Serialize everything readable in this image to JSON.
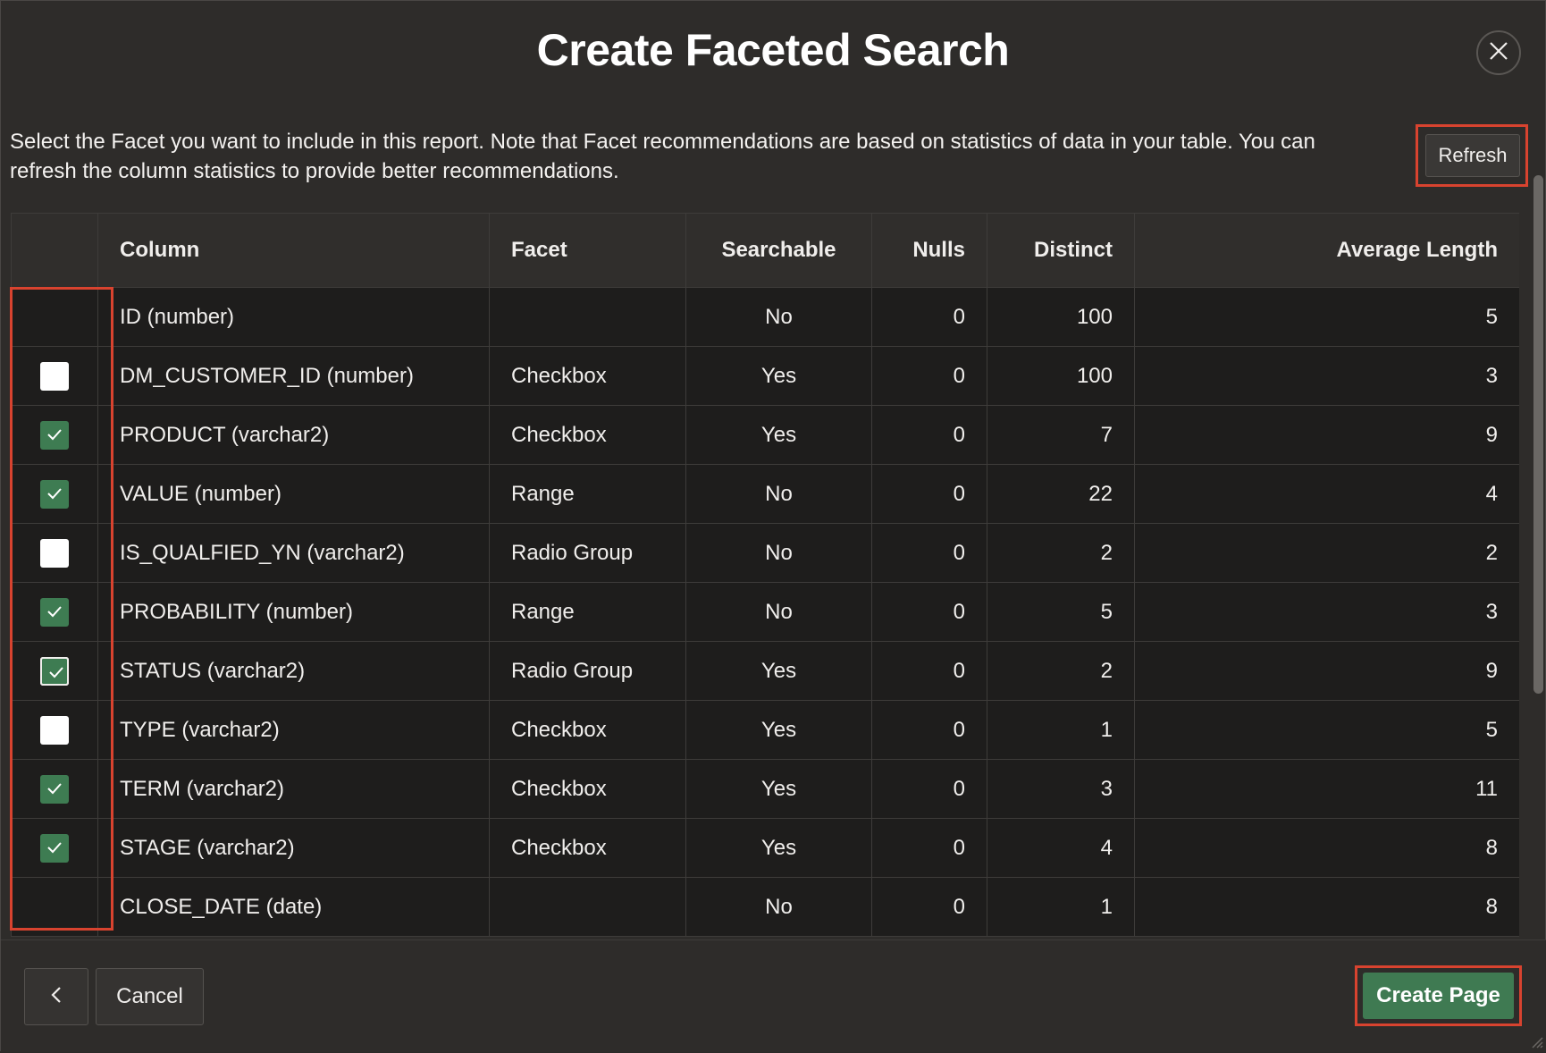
{
  "dialog": {
    "title": "Create Faceted Search",
    "intro": "Select the Facet you want to include in this report. Note that Facet recommendations are based on statistics of data in your table. You can refresh the column statistics to provide better recommendations.",
    "refresh_label": "Refresh",
    "close_icon": "close-icon"
  },
  "table": {
    "headers": {
      "select": "",
      "column": "Column",
      "facet": "Facet",
      "searchable": "Searchable",
      "nulls": "Nulls",
      "distinct": "Distinct",
      "avg_length": "Average Length"
    },
    "rows": [
      {
        "checkbox": "none",
        "column": "ID (number)",
        "facet": "",
        "searchable": "No",
        "nulls": "0",
        "distinct": "100",
        "avg_length": "5"
      },
      {
        "checkbox": "unchecked",
        "column": "DM_CUSTOMER_ID (number)",
        "facet": "Checkbox",
        "searchable": "Yes",
        "nulls": "0",
        "distinct": "100",
        "avg_length": "3"
      },
      {
        "checkbox": "checked",
        "column": "PRODUCT (varchar2)",
        "facet": "Checkbox",
        "searchable": "Yes",
        "nulls": "0",
        "distinct": "7",
        "avg_length": "9"
      },
      {
        "checkbox": "checked",
        "column": "VALUE (number)",
        "facet": "Range",
        "searchable": "No",
        "nulls": "0",
        "distinct": "22",
        "avg_length": "4"
      },
      {
        "checkbox": "unchecked",
        "column": "IS_QUALFIED_YN (varchar2)",
        "facet": "Radio Group",
        "searchable": "No",
        "nulls": "0",
        "distinct": "2",
        "avg_length": "2"
      },
      {
        "checkbox": "checked",
        "column": "PROBABILITY (number)",
        "facet": "Range",
        "searchable": "No",
        "nulls": "0",
        "distinct": "5",
        "avg_length": "3"
      },
      {
        "checkbox": "checked-focused",
        "column": "STATUS (varchar2)",
        "facet": "Radio Group",
        "searchable": "Yes",
        "nulls": "0",
        "distinct": "2",
        "avg_length": "9"
      },
      {
        "checkbox": "unchecked",
        "column": "TYPE (varchar2)",
        "facet": "Checkbox",
        "searchable": "Yes",
        "nulls": "0",
        "distinct": "1",
        "avg_length": "5"
      },
      {
        "checkbox": "checked",
        "column": "TERM (varchar2)",
        "facet": "Checkbox",
        "searchable": "Yes",
        "nulls": "0",
        "distinct": "3",
        "avg_length": "11"
      },
      {
        "checkbox": "checked",
        "column": "STAGE (varchar2)",
        "facet": "Checkbox",
        "searchable": "Yes",
        "nulls": "0",
        "distinct": "4",
        "avg_length": "8"
      },
      {
        "checkbox": "none",
        "column": "CLOSE_DATE (date)",
        "facet": "",
        "searchable": "No",
        "nulls": "0",
        "distinct": "1",
        "avg_length": "8"
      }
    ]
  },
  "footer": {
    "back_icon": "chevron-left-icon",
    "cancel_label": "Cancel",
    "create_label": "Create Page"
  },
  "colors": {
    "background": "#2e2c2a",
    "table_cell": "#1e1d1c",
    "checkbox_checked": "#3e7c52",
    "primary_button": "#3f7a52",
    "highlight": "#d8432f"
  }
}
